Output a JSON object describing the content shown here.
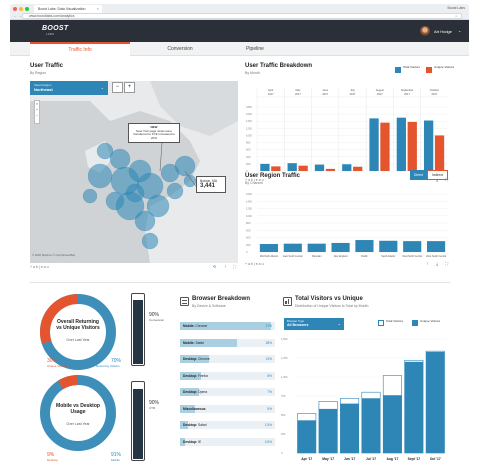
{
  "browser": {
    "tab_title": "Boost Labs: Data Visualization",
    "tab_close": "×",
    "url": "www.boostlabs.com/analytics",
    "profile_name": "Boost Labs",
    "nav_back": "←",
    "nav_forward": "→",
    "nav_reload": "C",
    "star": "☆"
  },
  "app": {
    "logo": "BOOST",
    "logo_sub": "LABS",
    "user_name": "Art Hodge",
    "user_caret": "⌄"
  },
  "tabs": [
    {
      "label": "Traffic Info",
      "active": true
    },
    {
      "label": "Conversion",
      "active": false
    },
    {
      "label": "Pipeline",
      "active": false
    }
  ],
  "user_traffic": {
    "title": "User Traffic",
    "subtitle": "By Region",
    "select_label": "Select Region",
    "select_value": "Northeast",
    "select_caret": "⌄",
    "zoom_out": "−",
    "zoom_in": "+",
    "callout_title": "NEW",
    "callout_text": "New York page views were transferred to FYE increased to 20%",
    "boston_label": "Boston, MA",
    "boston_value": "3,441",
    "map_credit": "© 2020 Mapbox © OpenStreetMap",
    "tableau": "+ a b | e a u"
  },
  "traffic_breakdown": {
    "title": "User Traffic Breakdown",
    "subtitle": "By Month",
    "legend": [
      {
        "label": "Total Visitors",
        "color": "#2e86b7"
      },
      {
        "label": "Unique Visitors",
        "color": "#e4552f"
      }
    ]
  },
  "chart_data": [
    {
      "type": "bar",
      "name": "traffic-breakdown",
      "categories": [
        "April 2017",
        "May 2017",
        "June 2017",
        "July 2017",
        "August 2017",
        "September 2017",
        "October 2017"
      ],
      "ylim": [
        0,
        1800
      ],
      "yticks": [
        "1800",
        "1600",
        "1400",
        "1200",
        "1000",
        "800",
        "600",
        "400",
        "200",
        "0"
      ],
      "series": [
        {
          "name": "Total Visitors",
          "color": "#2e86b7",
          "values": [
            200,
            220,
            180,
            190,
            1480,
            1500,
            1420
          ]
        },
        {
          "name": "Unique Visitors",
          "color": "#e4552f",
          "values": [
            130,
            150,
            60,
            120,
            1360,
            1380,
            1000
          ]
        }
      ]
    },
    {
      "type": "bar",
      "name": "region-traffic",
      "categories": [
        "Mid-North Atlantic",
        "East South Central",
        "Mountain",
        "New England",
        "Pacific",
        "South Atlantic",
        "West North Central",
        "West South Central"
      ],
      "ylim": [
        0,
        1600
      ],
      "yticks": [
        "1600",
        "1400",
        "1200",
        "1000",
        "800",
        "600",
        "400",
        "200",
        "0"
      ],
      "series": [
        {
          "name": "Direct",
          "color": "#2e86b7",
          "values": [
            220,
            230,
            230,
            250,
            330,
            310,
            300,
            300
          ]
        }
      ]
    },
    {
      "type": "bar",
      "name": "total-vs-unique",
      "categories": [
        "Apr '17",
        "May '17",
        "Jun '17",
        "Jul '17",
        "Aug '17",
        "Sept '17",
        "Oct '17"
      ],
      "ylim": [
        0,
        1800
      ],
      "yticks": [
        "1,500",
        "1,250",
        "1,000",
        "750",
        "500",
        "250",
        "0"
      ],
      "series": [
        {
          "name": "Total Visitors",
          "color": "#ffffff",
          "values": [
            520,
            680,
            720,
            800,
            1020,
            1220,
            1340
          ]
        },
        {
          "name": "Unique Visitors",
          "color": "#2e86b7",
          "values": [
            430,
            580,
            650,
            720,
            760,
            1200,
            1330
          ]
        }
      ]
    }
  ],
  "region_traffic": {
    "title": "User Region Traffic",
    "subtitle": "By Channel",
    "btn_direct": "Direct",
    "btn_indirect": "Indirect"
  },
  "donut1": {
    "title": "Overall Returning vs Unique Visitors",
    "sub": "Over Last Year",
    "left_pct": "30%",
    "left_label": "Unique Visitors",
    "right_pct": "70%",
    "right_label": "Returning Visitors",
    "bar_pct": "90%",
    "bar_label": "Conversion"
  },
  "donut2": {
    "title": "Mobile vs Desktop Usage",
    "sub": "Over Last Year",
    "left_pct": "9%",
    "left_label": "Desktop",
    "right_pct": "91%",
    "right_label": "Mobile",
    "bar_pct": "90%",
    "bar_label": "CTR"
  },
  "browser_breakdown": {
    "title": "Browser Breakdown",
    "subtitle": "By Device & Software",
    "rows": [
      {
        "device": "Mobile:",
        "browser": "Chrome",
        "value": "37%",
        "fill": 0.96
      },
      {
        "device": "Mobile:",
        "browser": "Safari",
        "value": "28%",
        "fill": 0.6
      },
      {
        "device": "Desktop:",
        "browser": "Chrome",
        "value": "13%",
        "fill": 0.3
      },
      {
        "device": "Desktop:",
        "browser": "Firefox",
        "value": "8%",
        "fill": 0.22
      },
      {
        "device": "Desktop:",
        "browser": "Opera",
        "value": "7%",
        "fill": 0.2
      },
      {
        "device": "Miscellaneous",
        "browser": "",
        "value": "5%",
        "fill": 0.16
      },
      {
        "device": "Desktop:",
        "browser": "Safari",
        "value": "1.5%",
        "fill": 0.08
      },
      {
        "device": "Desktop:",
        "browser": "IE",
        "value": "0.5%",
        "fill": 0.05
      }
    ]
  },
  "total_vs_unique": {
    "title": "Total Visitors vs Unique",
    "subtitle": "Distribution of Unique Visitors to Total by Month",
    "select_label": "Browser Type",
    "select_value": "All Browsers",
    "legend_total": "Total Visitors",
    "legend_unique": "Unique Visitors"
  }
}
